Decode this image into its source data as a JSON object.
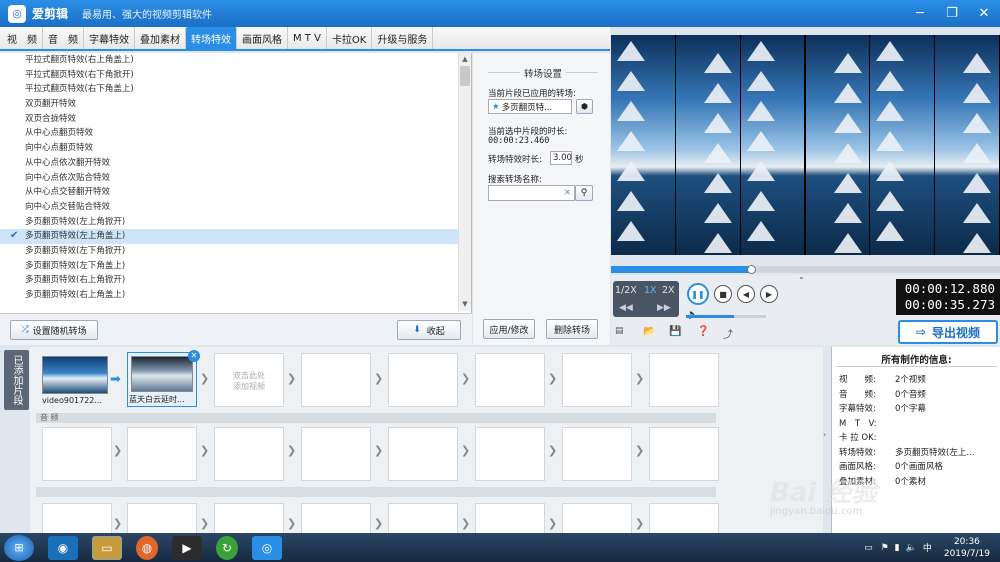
{
  "window": {
    "app_name": "爱剪辑",
    "slogan": "最易用、强大的视频剪辑软件",
    "logo": "◎"
  },
  "tabs": [
    "视　频",
    "音　频",
    "字幕特效",
    "叠加素材",
    "转场特效",
    "画面风格",
    "M T V",
    "卡拉OK",
    "升级与服务"
  ],
  "active_tab_index": 4,
  "transition_list": [
    "平拉式翻页特效(右上角盖上)",
    "平拉式翻页特效(右下角掀开)",
    "平拉式翻页特效(右下角盖上)",
    "双页翻开特效",
    "双页合拢特效",
    "从中心点翻页特效",
    "向中心点翻页特效",
    "从中心点依次翻开特效",
    "向中心点依次贴合特效",
    "从中心点交替翻开特效",
    "向中心点交替贴合特效",
    "多页翻页特效(左上角掀开)",
    "多页翻页特效(左上角盖上)",
    "多页翻页特效(左下角掀开)",
    "多页翻页特效(左下角盖上)",
    "多页翻页特效(右上角掀开)",
    "多页翻页特效(右上角盖上)"
  ],
  "selected_index": 12,
  "left_buttons": {
    "random": "设置随机转场",
    "collapse": "收起"
  },
  "settings": {
    "header": "转场设置",
    "applied_label": "当前片段已应用的转场:",
    "applied_value": "多页翻页特...",
    "duration_label": "当前选中片段的时长:",
    "duration_value": "00:00:23.460",
    "effect_duration_label": "转场特效时长:",
    "effect_duration_value": "3.00",
    "effect_duration_unit": "秒",
    "search_label": "搜索转场名称:",
    "search_value": "",
    "apply_button": "应用/修改",
    "delete_button": "删除转场"
  },
  "player": {
    "speeds": [
      "1/2X",
      "1X",
      "2X"
    ],
    "active_speed": "1X",
    "current_time": "00:00:12.880",
    "total_time": "00:00:35.273",
    "progress_fraction": 0.36,
    "volume_fraction": 0.6,
    "export_label": "导出视频"
  },
  "timeline": {
    "side_label": "已添加片段",
    "audio_label": "音 频",
    "clips": [
      {
        "name": "video901722..."
      },
      {
        "name": "蓝天白云延时..."
      }
    ],
    "placeholder": "双击此处\n添加视频"
  },
  "info": {
    "header": "所有制作的信息:",
    "rows": [
      {
        "k": "视　　频:",
        "v": "2个视频"
      },
      {
        "k": "音　　频:",
        "v": "0个音频"
      },
      {
        "k": "字幕特效:",
        "v": "0个字幕"
      },
      {
        "k": "M　T　V:",
        "v": ""
      },
      {
        "k": "卡 拉 OK:",
        "v": ""
      },
      {
        "k": "转场特效:",
        "v": "多页翻页特效(左上..."
      },
      {
        "k": "画面风格:",
        "v": "0个画面风格"
      },
      {
        "k": "叠加素材:",
        "v": "0个素材"
      }
    ]
  },
  "taskbar": {
    "time": "20:36",
    "date": "2019/7/19"
  },
  "watermark": {
    "main": "Bai 经验",
    "sub": "jingyan.baidu.com"
  },
  "colors": {
    "accent": "#2b8ee6"
  }
}
